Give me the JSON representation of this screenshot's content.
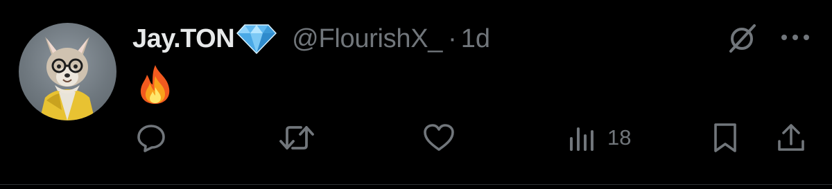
{
  "tweet": {
    "author": {
      "display_name": "Jay.TON",
      "handle": "@FlourishX_",
      "verified_badge_icon": "diamond-icon"
    },
    "separator": "·",
    "timestamp": "1d",
    "content": {
      "emoji_icon": "fire-emoji",
      "emoji_text": "🔥"
    },
    "actions": {
      "reply_icon": "comment-bubble-icon",
      "retweet_icon": "repost-icon",
      "like_icon": "heart-icon",
      "views_icon": "bar-chart-icon",
      "views_count": "18",
      "bookmark_icon": "bookmark-icon",
      "share_icon": "share-upload-icon"
    },
    "header_icons": {
      "grok_icon": "grok-slash-circle-icon",
      "more_icon": "more-dots-icon"
    }
  },
  "colors": {
    "background": "#000000",
    "primary_text": "#e7e9ea",
    "secondary_text": "#71767b",
    "divider": "#2f3336",
    "diamond": "#5fb8f0"
  }
}
